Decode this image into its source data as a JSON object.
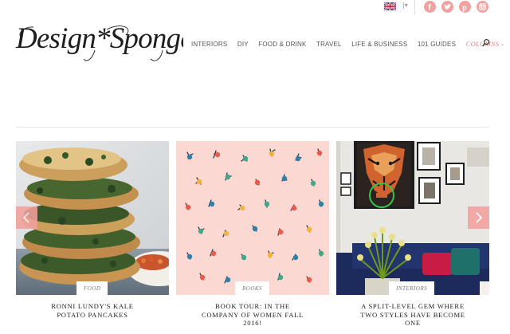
{
  "header": {
    "logo_text": "Design*Sponge",
    "language": {
      "flag": "uk-flag-icon",
      "caret": "|▾"
    },
    "social": [
      {
        "name": "facebook-icon"
      },
      {
        "name": "twitter-icon"
      },
      {
        "name": "pinterest-icon"
      },
      {
        "name": "instagram-icon"
      }
    ],
    "nav": [
      {
        "label": "INTERIORS"
      },
      {
        "label": "DIY"
      },
      {
        "label": "FOOD & DRINK"
      },
      {
        "label": "TRAVEL"
      },
      {
        "label": "LIFE & BUSINESS"
      },
      {
        "label": "101 GUIDES"
      },
      {
        "label": "COLUMNS",
        "caret": "›"
      }
    ]
  },
  "slider": {
    "prev_label": "‹",
    "next_label": "›",
    "cards": [
      {
        "tag": "FOOD",
        "title_lines": [
          "RONNI LUNDY'S KALE",
          "POTATO PANCAKES"
        ]
      },
      {
        "tag": "BOOKS",
        "title_lines": [
          "BOOK TOUR: IN THE",
          "COMPANY OF WOMEN FALL",
          "2016!"
        ]
      },
      {
        "tag": "INTERIORS",
        "title_lines": [
          "A SPLIT-LEVEL GEM WHERE",
          "TWO STYLES HAVE BECOME",
          "ONE"
        ]
      }
    ]
  },
  "colors": {
    "accent": "#e0837f",
    "social": "#f0a2a0",
    "arrow": "#f2a19c",
    "books_bg": "#fbd8d1"
  }
}
